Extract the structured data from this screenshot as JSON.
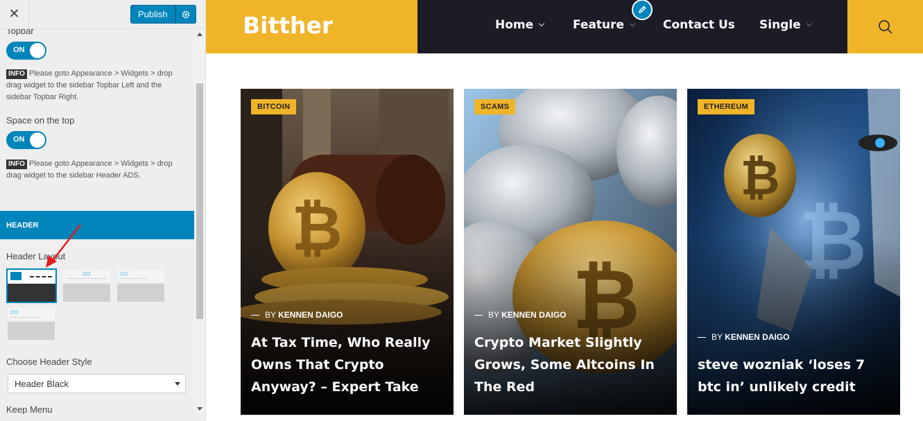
{
  "customizer": {
    "close_icon": "close-icon",
    "publish_label": "Publish",
    "settings_icon": "gear-icon",
    "topbar_label": "Topbar",
    "topbar_toggle": "ON",
    "info_badge": "INFO",
    "info_topbar": "Please goto Appearance > Widgets > drop drag widget to the sidebar Topbar Left and the sidebar Topbar Right.",
    "space_top_label": "Space on the top",
    "space_top_toggle": "ON",
    "info_header_ads": "Please goto Appearance > Widgets > drop drag widget to the sidebar Header ADS.",
    "section_header": "HEADER",
    "header_layout_label": "Header Layout",
    "header_style_label": "Choose Header Style",
    "header_style_value": "Header Black",
    "keep_menu_label": "Keep Menu"
  },
  "site": {
    "logo": "Bitther",
    "nav": [
      {
        "label": "Home",
        "has_dropdown": true
      },
      {
        "label": "Feature",
        "has_dropdown": true
      },
      {
        "label": "Contact Us",
        "has_dropdown": false
      },
      {
        "label": "Single",
        "has_dropdown": true
      }
    ],
    "brand_color": "#f0b429",
    "nav_bg": "#1c1b26",
    "accent": "#0085ba"
  },
  "cards": [
    {
      "category": "BITCOIN",
      "by": "BY",
      "author": "KENNEN DAIGO",
      "title": "At Tax Time, Who Really Owns That Crypto Anyway? – Expert Take"
    },
    {
      "category": "SCAMS",
      "by": "BY",
      "author": "KENNEN DAIGO",
      "title": "Crypto Market Slightly Grows, Some Altcoins In The Red"
    },
    {
      "category": "ETHEREUM",
      "by": "BY",
      "author": "KENNEN DAIGO",
      "title": "steve wozniak ‘loses 7 btc in’ unlikely credit"
    }
  ]
}
